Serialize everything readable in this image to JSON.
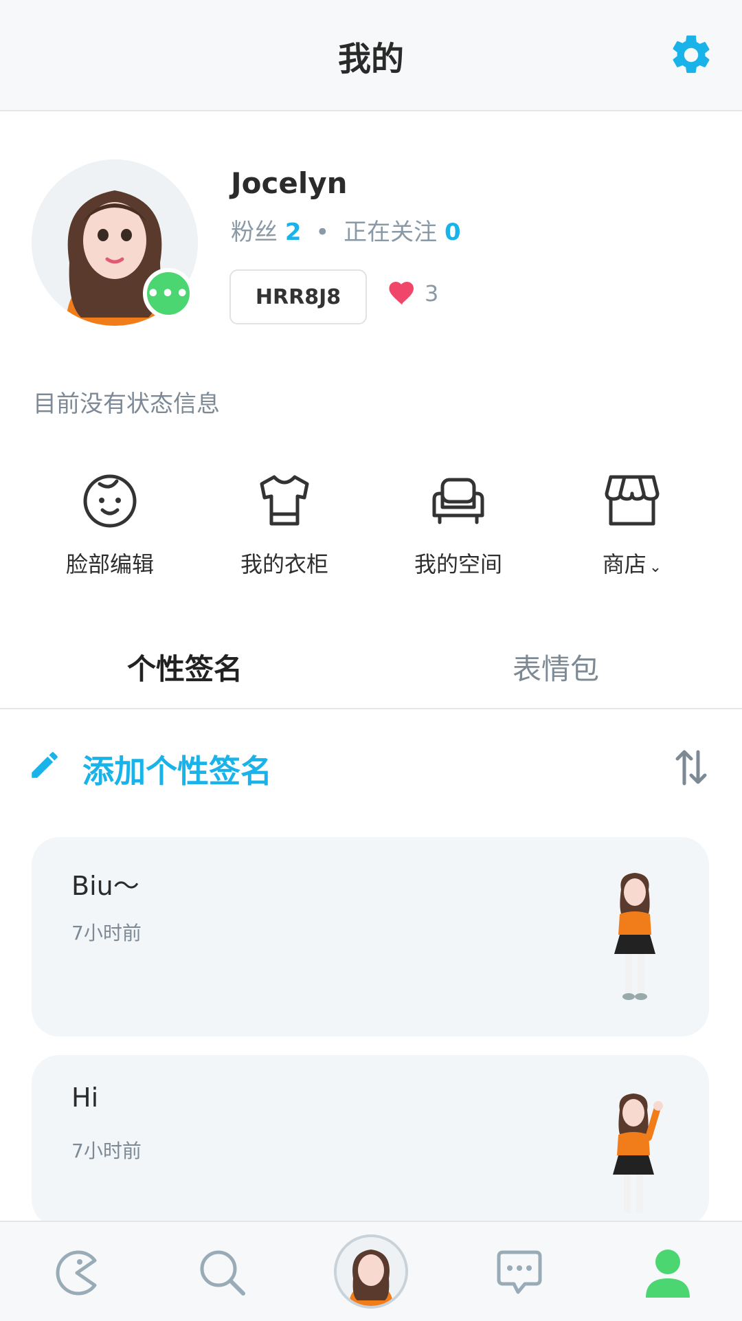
{
  "header": {
    "title": "我的"
  },
  "profile": {
    "username": "Jocelyn",
    "followers_label": "粉丝",
    "followers_count": "2",
    "separator": "•",
    "following_label": "正在关注",
    "following_count": "0",
    "code": "HRR8J8",
    "likes": "3",
    "status_text": "目前没有状态信息"
  },
  "quick_actions": [
    {
      "label": "脸部编辑",
      "icon": "face-icon"
    },
    {
      "label": "我的衣柜",
      "icon": "shirt-icon"
    },
    {
      "label": "我的空间",
      "icon": "sofa-icon"
    },
    {
      "label": "商店",
      "icon": "store-icon"
    }
  ],
  "tabs": [
    {
      "label": "个性签名"
    },
    {
      "label": "表情包"
    }
  ],
  "signature": {
    "add_label": "添加个性签名"
  },
  "posts": [
    {
      "text": "Biu～",
      "time": "7小时前"
    },
    {
      "text": "Hi",
      "time": "7小时前"
    }
  ],
  "colors": {
    "accent": "#19b3ea",
    "green": "#4cd671",
    "heart": "#f0466a",
    "muted": "#7d8a96"
  }
}
